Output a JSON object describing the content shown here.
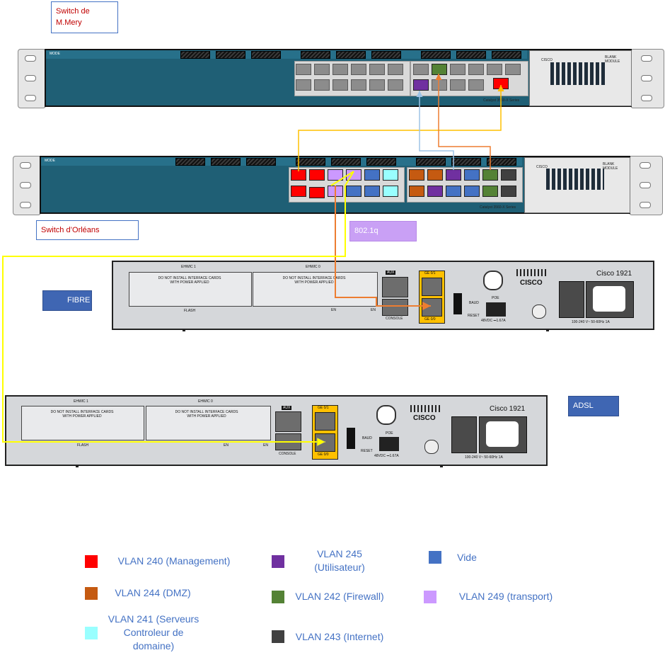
{
  "labels": {
    "switch_mery": "Switch de\nM.Mery",
    "switch_orleans": "Switch d’Orléans",
    "dot1q": "802.1q",
    "fibre": "FIBRE",
    "adsl": "ADSL"
  },
  "router": {
    "model": "Cisco 1921",
    "brand": "CISCO",
    "ehwic1": "EHWIC 1",
    "ehwic0": "EHWIC 0",
    "slot_text": "DO NOT INSTALL INTERFACE CARDS WITH POWER APPLIED",
    "flash": "FLASH",
    "aux": "AUX",
    "console": "CONSOLE",
    "en": "EN",
    "ge01": "GE 0/1",
    "ge00": "GE 0/0",
    "baud": "BAUD",
    "reset": "RESET",
    "poe": "POE",
    "poe_rating": "48VDC ⎓1.67A",
    "power_rating": "100-240 V~ 50-60Hz 1A"
  },
  "switch": {
    "mode": "MODE",
    "brand": "CISCO",
    "blank_module": "BLANK MODULE",
    "series": "Catalyst 3560-X Series"
  },
  "colors": {
    "vlan240": "#ff0000",
    "vlan244": "#c55a11",
    "vlan241": "#99ffff",
    "vlan245": "#7030a0",
    "vlan242": "#548235",
    "vlan243": "#404040",
    "vide": "#4472c4",
    "vlan249": "#cc99ff",
    "link_yellow": "#ffff00",
    "link_orange": "#ed7d31",
    "link_lightblue": "#9dc3e6",
    "link_gold": "#ffc000"
  },
  "legend": [
    {
      "label": "VLAN 240 (Management)",
      "color_key": "vlan240"
    },
    {
      "label": "VLAN 245\n(Utilisateur)",
      "color_key": "vlan245"
    },
    {
      "label": "Vide",
      "color_key": "vide"
    },
    {
      "label": "VLAN 244 (DMZ)",
      "color_key": "vlan244"
    },
    {
      "label": "VLAN 242 (Firewall)",
      "color_key": "vlan242"
    },
    {
      "label": "VLAN 249 (transport)",
      "color_key": "vlan249"
    },
    {
      "label": "VLAN 241 (Serveurs\nControleur de\ndomaine)",
      "color_key": "vlan241"
    },
    {
      "label": "VLAN 243 (Internet)",
      "color_key": "vlan243"
    }
  ]
}
